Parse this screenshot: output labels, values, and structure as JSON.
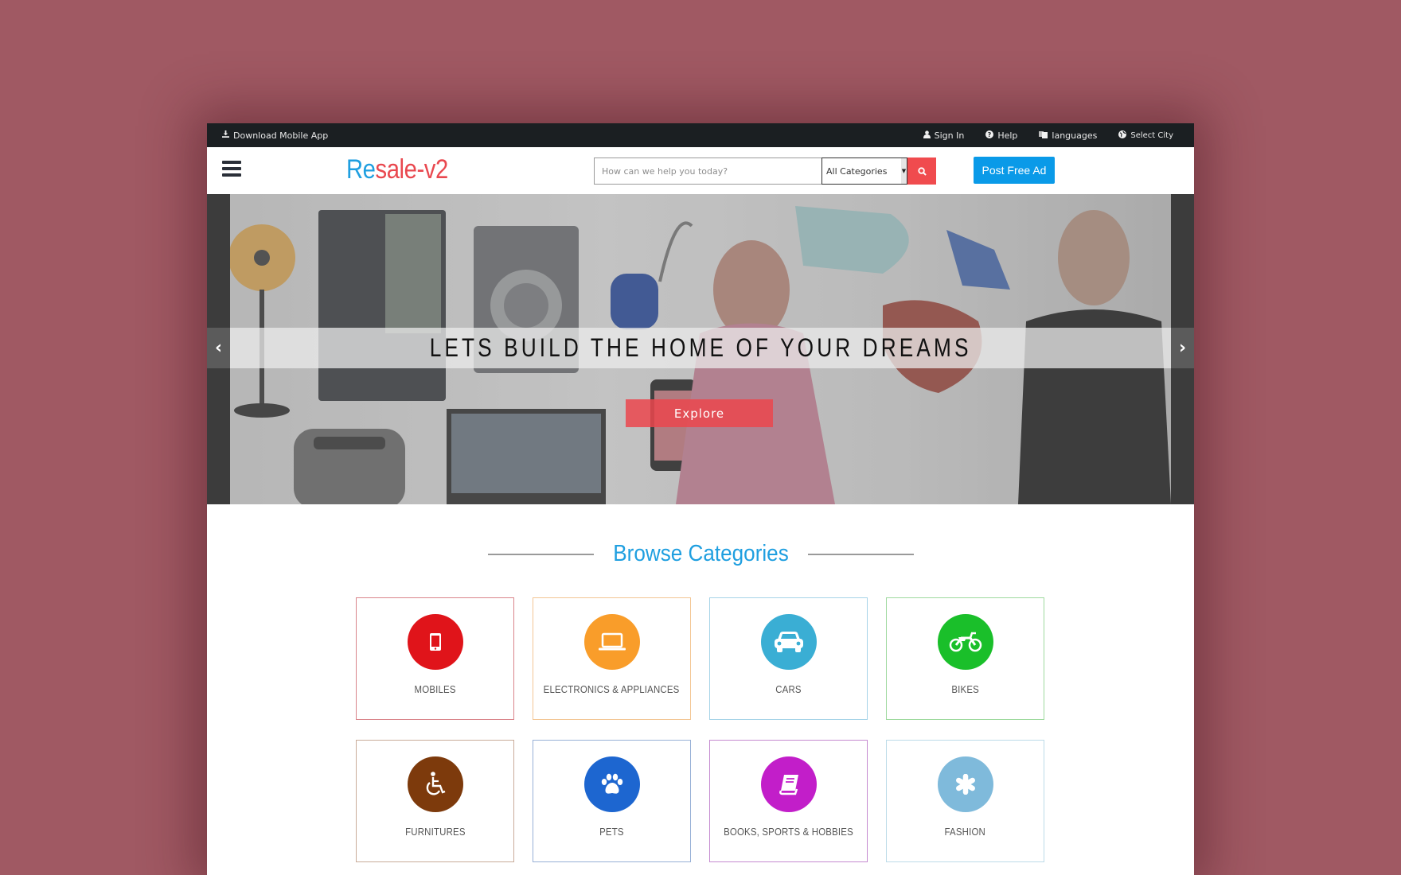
{
  "topbar": {
    "download_app": "Download Mobile App",
    "sign_in": "Sign In",
    "help": "Help",
    "languages": "languages",
    "select_city": "Select City"
  },
  "header": {
    "logo_part1": "Re",
    "logo_part2": "sale-v2",
    "search_placeholder": "How can we help you today?",
    "search_value": "",
    "category_selected": "All Categories",
    "post_ad_label": "Post Free Ad"
  },
  "hero": {
    "caption": "LETS BUILD THE HOME OF YOUR DREAMS",
    "button_label": "Explore",
    "prev_arrow": "‹",
    "next_arrow": "›"
  },
  "browse": {
    "title": "Browse Categories",
    "categories": [
      {
        "label": "MOBILES",
        "icon": "mobile-phone-icon",
        "color": "#e0141a",
        "border": "#d9848a"
      },
      {
        "label": "ELECTRONICS & APPLIANCES",
        "icon": "laptop-icon",
        "color": "#f99d2a",
        "border": "#f3c694"
      },
      {
        "label": "CARS",
        "icon": "car-icon",
        "color": "#3aaed4",
        "border": "#a6d3e8"
      },
      {
        "label": "BIKES",
        "icon": "motorcycle-icon",
        "color": "#1abf2a",
        "border": "#9ed99e"
      },
      {
        "label": "FURNITURES",
        "icon": "wheelchair-icon",
        "color": "#7d3a0c",
        "border": "#c9ab99"
      },
      {
        "label": "PETS",
        "icon": "paw-icon",
        "color": "#1d66d0",
        "border": "#97b0d6"
      },
      {
        "label": "BOOKS, SPORTS & HOBBIES",
        "icon": "book-icon",
        "color": "#c21ec9",
        "border": "#c58ad0"
      },
      {
        "label": "FASHION",
        "icon": "asterisk-icon",
        "color": "#7fbadb",
        "border": "#bcdbe8"
      }
    ]
  },
  "colors": {
    "brand_blue": "#1f9fe0",
    "brand_red": "#e9484f",
    "topbar_bg": "#1b1f22",
    "post_ad_bg": "#0a9ae8",
    "search_button_bg": "#f04b4e",
    "page_bg": "#a05963"
  }
}
